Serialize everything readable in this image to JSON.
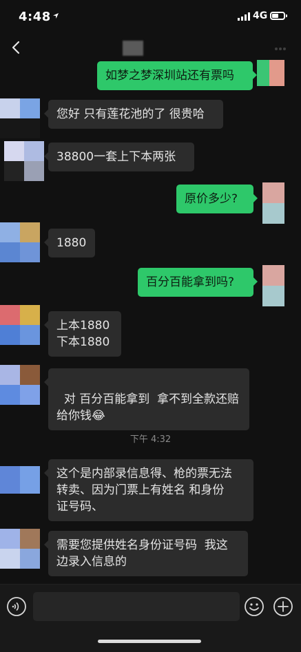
{
  "status_bar": {
    "time": "4:48",
    "network": "4G"
  },
  "chat": {
    "timestamp": "下午 4:32",
    "messages": [
      {
        "side": "out",
        "text": "如梦之梦深圳站还有票吗"
      },
      {
        "side": "in",
        "text": "您好 只有莲花池的了 很贵哈"
      },
      {
        "side": "in",
        "text": "38800一套上下本两张"
      },
      {
        "side": "out",
        "text": "原价多少?"
      },
      {
        "side": "in",
        "text": "1880"
      },
      {
        "side": "out",
        "text": "百分百能拿到吗?"
      },
      {
        "side": "in",
        "text": "上本1880\n下本1880"
      },
      {
        "side": "in",
        "text": "对 百分百能拿到  拿不到全款还赔\n给你钱",
        "emoji": "😂"
      },
      {
        "side": "in",
        "text": "这个是内部录信息得、枪的票无法\n转卖、因为门票上有姓名 和身份\n证号码、"
      },
      {
        "side": "in",
        "text": "需要您提供姓名身份证号码  我这\n边录入信息的"
      }
    ]
  },
  "colors": {
    "outgoing_bubble": "#2ec86a",
    "incoming_bubble": "#2c2c2c",
    "background": "#111111"
  }
}
